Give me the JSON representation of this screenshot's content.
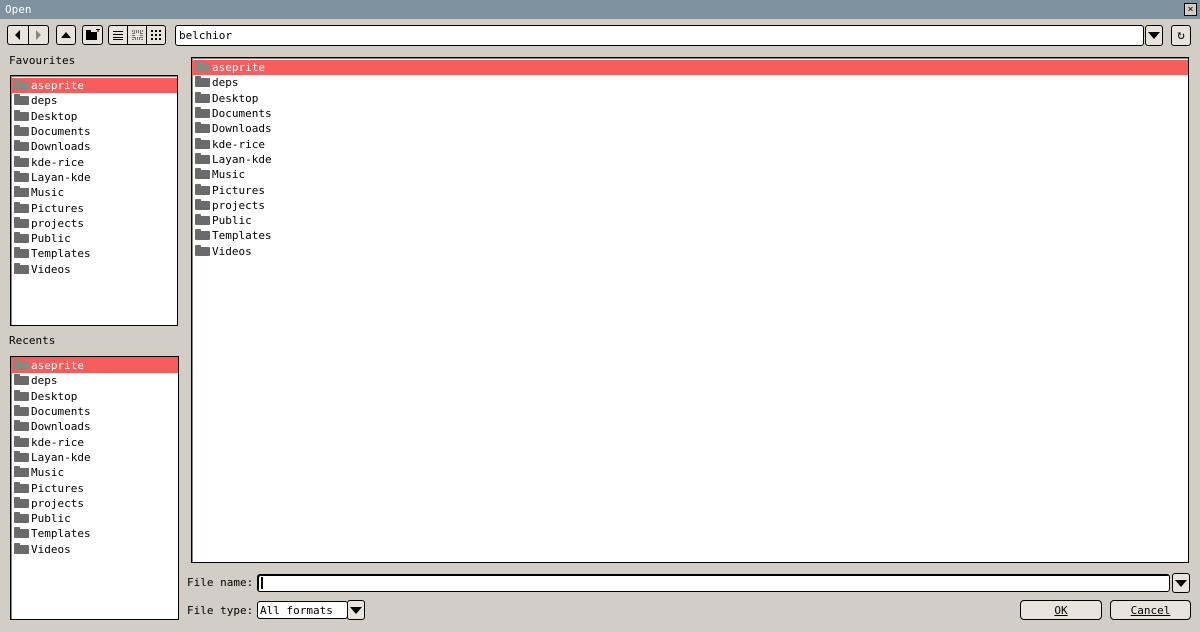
{
  "window": {
    "title": "Open",
    "close_glyph": "×"
  },
  "toolbar": {
    "icons": [
      "back-icon",
      "forward-icon",
      "up-icon",
      "new-folder-icon",
      "list-view-icon",
      "small-icons-view-icon",
      "big-icons-view-icon",
      "refresh-icon"
    ],
    "refresh_glyph": "↻"
  },
  "location": {
    "path": "belchior"
  },
  "favourites": {
    "label": "Favourites",
    "items": [
      "aseprite",
      "deps",
      "Desktop",
      "Documents",
      "Downloads",
      "kde-rice",
      "Layan-kde",
      "Music",
      "Pictures",
      "projects",
      "Public",
      "Templates",
      "Videos"
    ],
    "selected": 0
  },
  "recents": {
    "label": "Recents",
    "items": [
      "aseprite",
      "deps",
      "Desktop",
      "Documents",
      "Downloads",
      "kde-rice",
      "Layan-kde",
      "Music",
      "Pictures",
      "projects",
      "Public",
      "Templates",
      "Videos"
    ],
    "selected": 0
  },
  "files": {
    "items": [
      "aseprite",
      "deps",
      "Desktop",
      "Documents",
      "Downloads",
      "kde-rice",
      "Layan-kde",
      "Music",
      "Pictures",
      "projects",
      "Public",
      "Templates",
      "Videos"
    ],
    "selected": 0
  },
  "file_name": {
    "label": "File name:",
    "value": ""
  },
  "file_type": {
    "label": "File type:",
    "value": "All formats"
  },
  "buttons": {
    "ok": "OK",
    "cancel": "Cancel"
  },
  "colors": {
    "selection": "#f75d5d",
    "titlebar": "#7d929e",
    "background": "#d3cec5"
  }
}
